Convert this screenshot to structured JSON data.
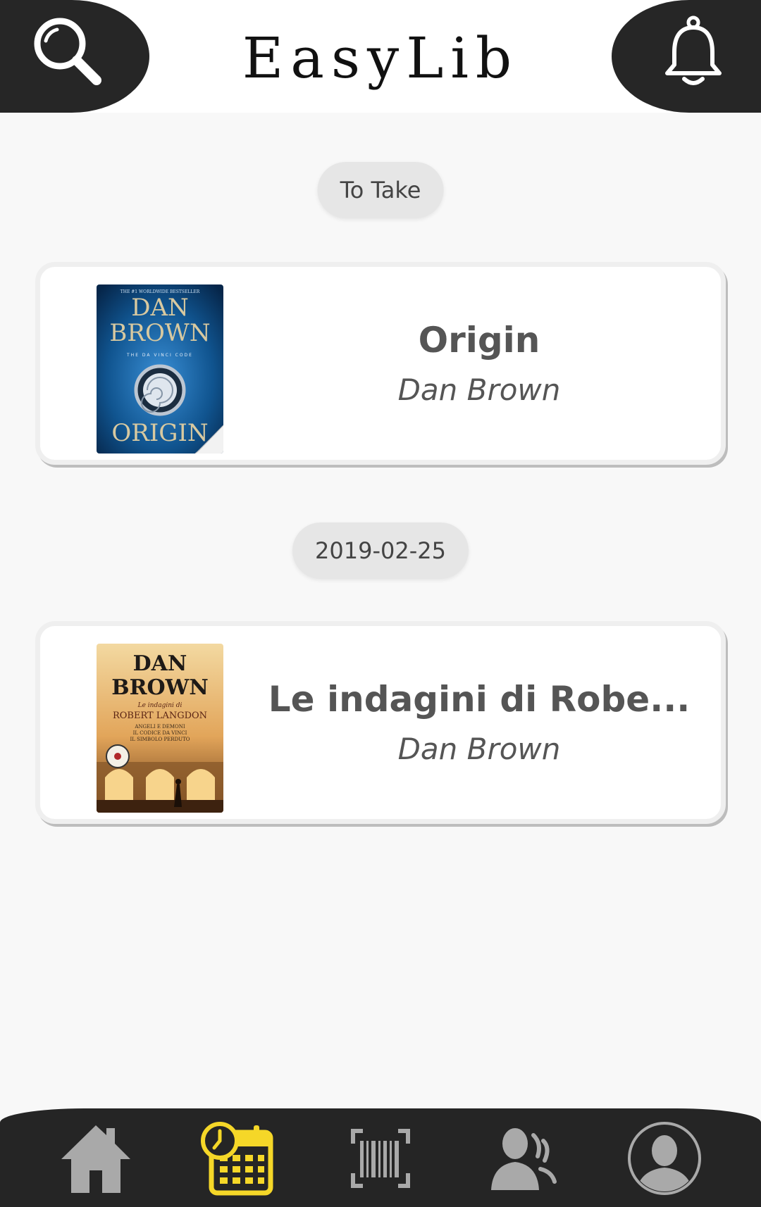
{
  "header": {
    "title": "EasyLib",
    "search_icon": "search-icon",
    "notifications_icon": "bell-icon"
  },
  "sections": [
    {
      "label": "To Take",
      "book": {
        "title": "Origin",
        "author": "Dan Brown"
      }
    },
    {
      "label": "2019-02-25",
      "book": {
        "title": "Le indagini di Robe...",
        "author": "Dan Brown"
      }
    }
  ],
  "covers": {
    "origin": {
      "top_line": "THE #1 WORLDWIDE BESTSELLER",
      "author_line_1": "DAN",
      "author_line_2": "BROWN",
      "tagline": "THE DA VINCI CODE",
      "title": "ORIGIN"
    },
    "indagini": {
      "author_line_1": "DAN",
      "author_line_2": "BROWN",
      "subtitle": "Le indagini di",
      "character": "ROBERT LANGDON",
      "books": [
        "ANGELI E DEMONI",
        "IL CODICE DA VINCI",
        "IL SIMBOLO PERDUTO"
      ]
    }
  },
  "bottom_nav": {
    "items": [
      "home-icon",
      "calendar-clock-icon",
      "barcode-icon",
      "community-icon",
      "profile-icon"
    ],
    "active": "calendar-clock-icon",
    "active_color": "#f5d728",
    "inactive_color": "#a9a9a9"
  },
  "colors": {
    "header_dark": "#262626",
    "background": "#f8f8f8",
    "card": "#ffffff",
    "chip": "#e6e6e6"
  }
}
